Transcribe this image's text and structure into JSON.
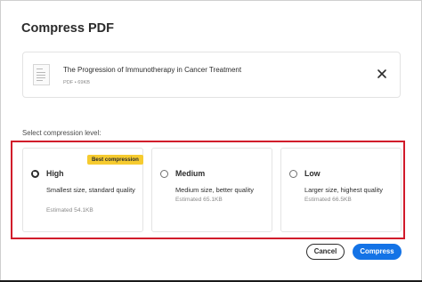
{
  "dialog": {
    "title": "Compress PDF"
  },
  "file": {
    "name": "The Progression of Immunotherapy in Cancer Treatment",
    "meta": "PDF • 69KB",
    "thumbnail_icon": "pdf-document-icon",
    "close_icon": "close-icon"
  },
  "compression": {
    "label": "Select compression level:",
    "selected": "High",
    "options": [
      {
        "title": "High",
        "badge": "Best compression",
        "description": "Smallest size, standard quality",
        "estimate": "Estimated 54.1KB",
        "checked": true
      },
      {
        "title": "Medium",
        "description": "Medium size, better quality",
        "estimate": "Estimated 65.1KB",
        "checked": false
      },
      {
        "title": "Low",
        "description": "Larger size, highest quality",
        "estimate": "Estimated 66.5KB",
        "checked": false
      }
    ]
  },
  "actions": {
    "cancel_label": "Cancel",
    "compress_label": "Compress"
  },
  "colors": {
    "primary": "#1473e6",
    "badge": "#f6cb2f",
    "highlight_border": "#d11a2a"
  }
}
